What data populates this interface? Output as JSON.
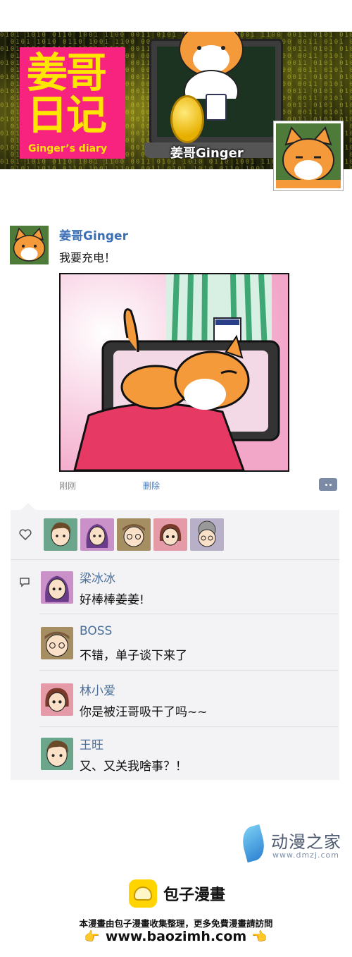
{
  "banner": {
    "logo_line1": "姜哥",
    "logo_line2": "日记",
    "logo_sub": "Ginger’s diary",
    "character_name": "姜哥Ginger",
    "binary_bg": "0101 1010 0110 1001 1100 0011 0101 1010 0110 1001 1100 0011 0101"
  },
  "post": {
    "author": "姜哥Ginger",
    "text": "我要充电！",
    "time": "刚刚",
    "delete_label": "删除"
  },
  "likes": {
    "icon": "heart-icon",
    "avatars": [
      "avatar-wangwang",
      "avatar-liangbingbing",
      "avatar-boss",
      "avatar-linxiaoai",
      "avatar-grandma"
    ]
  },
  "comments": {
    "icon": "comment-icon",
    "items": [
      {
        "name": "梁冰冰",
        "text": "好棒棒姜姜!"
      },
      {
        "name": "BOSS",
        "text": "不错，单子谈下来了"
      },
      {
        "name": "林小爱",
        "text": "你是被汪哥吸干了吗~~"
      },
      {
        "name": "王旺",
        "text": "又、又关我啥事？！"
      }
    ]
  },
  "watermark_dmzj": {
    "title": "动漫之家",
    "url": "www.dmzj.com"
  },
  "watermark_bao": {
    "name": "包子漫畫",
    "description": "本漫畫由包子漫畫收集整理，更多免費漫畫請訪問",
    "url": "www.baozimh.com",
    "pointer_icon": "👉",
    "pointer_icon_left": "👉"
  },
  "colors": {
    "author_blue": "#3b6fb6",
    "logo_pink": "#f7237f",
    "logo_yellow": "#ffe600",
    "panel_bg": "#f3f3f5"
  }
}
